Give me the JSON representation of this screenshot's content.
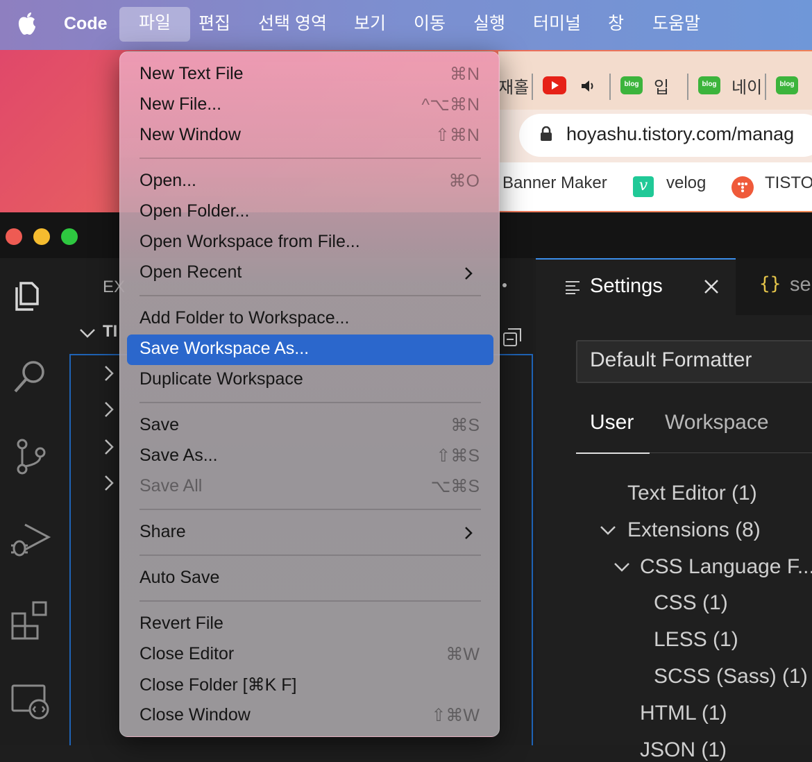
{
  "menubar": {
    "app_name": "Code",
    "items": [
      "파일",
      "편집",
      "선택 영역",
      "보기",
      "이동",
      "실행",
      "터미널",
      "창",
      "도움말"
    ]
  },
  "browser": {
    "tab_fragments": [
      "재홀",
      "입",
      "네이"
    ],
    "url": "hoyashu.tistory.com/manag",
    "bookmarks": [
      "Banner Maker",
      "velog",
      "TISTO"
    ],
    "blog_badge": "blog"
  },
  "vscode": {
    "explorer_title": "EX",
    "explorer_section": "TI",
    "tabs": {
      "settings_label": "Settings",
      "json_icon": "{}",
      "json_label": "se"
    },
    "settings": {
      "search_value": "Default Formatter",
      "scopes": [
        "User",
        "Workspace"
      ],
      "toc": [
        "Text Editor (1)",
        "Extensions (8)",
        "CSS Language F...",
        "CSS (1)",
        "LESS (1)",
        "SCSS (Sass) (1)",
        "HTML (1)",
        "JSON (1)"
      ]
    }
  },
  "file_menu": {
    "items": [
      {
        "label": "New Text File",
        "shortcut": "⌘N"
      },
      {
        "label": "New File...",
        "shortcut": "^⌥⌘N"
      },
      {
        "label": "New Window",
        "shortcut": "⇧⌘N"
      },
      {
        "label": "Open...",
        "shortcut": "⌘O"
      },
      {
        "label": "Open Folder...",
        "shortcut": ""
      },
      {
        "label": "Open Workspace from File...",
        "shortcut": ""
      },
      {
        "label": "Open Recent",
        "shortcut": "",
        "submenu": true
      },
      {
        "label": "Add Folder to Workspace...",
        "shortcut": ""
      },
      {
        "label": "Save Workspace As...",
        "shortcut": "",
        "highlighted": true
      },
      {
        "label": "Duplicate Workspace",
        "shortcut": ""
      },
      {
        "label": "Save",
        "shortcut": "⌘S"
      },
      {
        "label": "Save As...",
        "shortcut": "⇧⌘S"
      },
      {
        "label": "Save All",
        "shortcut": "⌥⌘S",
        "disabled": true
      },
      {
        "label": "Share",
        "shortcut": "",
        "submenu": true
      },
      {
        "label": "Auto Save",
        "shortcut": ""
      },
      {
        "label": "Revert File",
        "shortcut": ""
      },
      {
        "label": "Close Editor",
        "shortcut": "⌘W"
      },
      {
        "label": "Close Folder [⌘K F]",
        "shortcut": ""
      },
      {
        "label": "Close Window",
        "shortcut": "⇧⌘W"
      }
    ]
  },
  "colors": {
    "menu_highlight": "#2b67cc",
    "focus_border": "#1f63b5",
    "tab_active_border": "#3b8eea",
    "traffic_close": "#ee5b53",
    "traffic_min": "#f5bc2f",
    "traffic_max": "#2ec840"
  }
}
